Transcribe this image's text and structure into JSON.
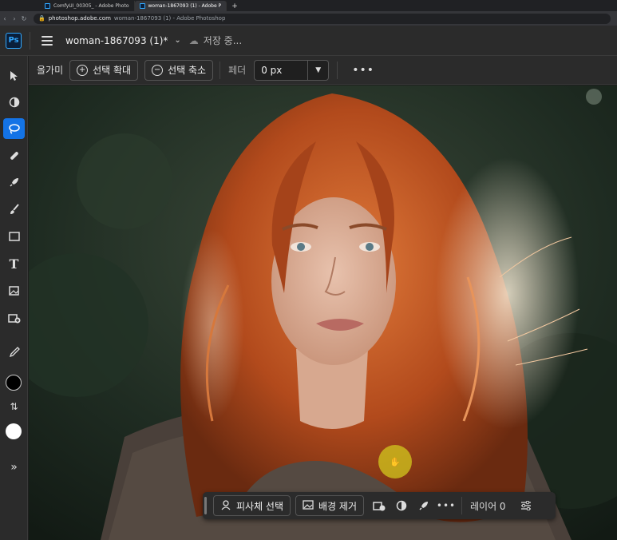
{
  "browser": {
    "tabs": [
      {
        "label": "ComfyUI_00305_ - Adobe Photo",
        "active": false
      },
      {
        "label": "woman-1867093 (1) - Adobe P",
        "active": true
      }
    ],
    "url_host": "photoshop.adobe.com",
    "url_rest": "woman-1867093 (1) - Adobe Photoshop"
  },
  "app": {
    "logo": "Ps",
    "doc_name": "woman-1867093 (1)*",
    "save_status": "저장 중..."
  },
  "options": {
    "tool_label": "올가미",
    "expand_label": "선택 확대",
    "contract_label": "선택 축소",
    "feather_label": "페더",
    "feather_value": "0 px"
  },
  "context_bar": {
    "select_subject": "피사체 선택",
    "remove_bg": "배경 제거",
    "layer": "레이어 0"
  },
  "colors": {
    "accent": "#1473e6",
    "foreground_swatch": "#000000",
    "background_swatch": "#ffffff",
    "hair": "#b4501e",
    "background_foliage": "#1f2c22"
  }
}
